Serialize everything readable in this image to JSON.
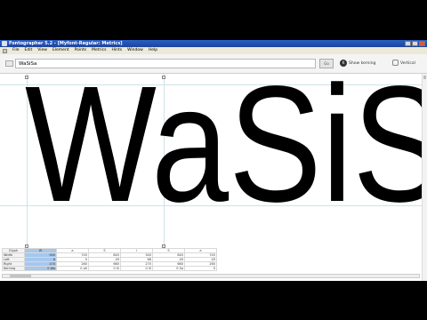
{
  "window": {
    "title": "Fontographer 5.2 - [Myfont-Regular: Metrics]"
  },
  "menu": [
    "File",
    "Edit",
    "View",
    "Element",
    "Points",
    "Metrics",
    "Hints",
    "Window",
    "Help"
  ],
  "toolbar": {
    "text_value": "WaSiSa",
    "go_label": "Go",
    "show_kerning_label": "Show kerning",
    "vertical_label": "Vertical"
  },
  "canvas": {
    "sample_text": "WaSiSa"
  },
  "metrics_table": {
    "row_labels": [
      "Glyph",
      "Width",
      "Left",
      "Right",
      "Kerning"
    ],
    "glyphs": [
      "W",
      "a",
      "S",
      "i",
      "S",
      "a"
    ],
    "widths": [
      "945",
      "745",
      "845",
      "340",
      "845",
      "745"
    ],
    "left": [
      "6",
      "0",
      "49",
      "66",
      "49",
      "49"
    ],
    "right": [
      "270",
      "260",
      "660",
      "270",
      "660",
      "260"
    ],
    "kerning": [
      "0  Wa",
      "0  aS",
      "0  Si",
      "0  iS",
      "0  Sa",
      "0"
    ]
  }
}
